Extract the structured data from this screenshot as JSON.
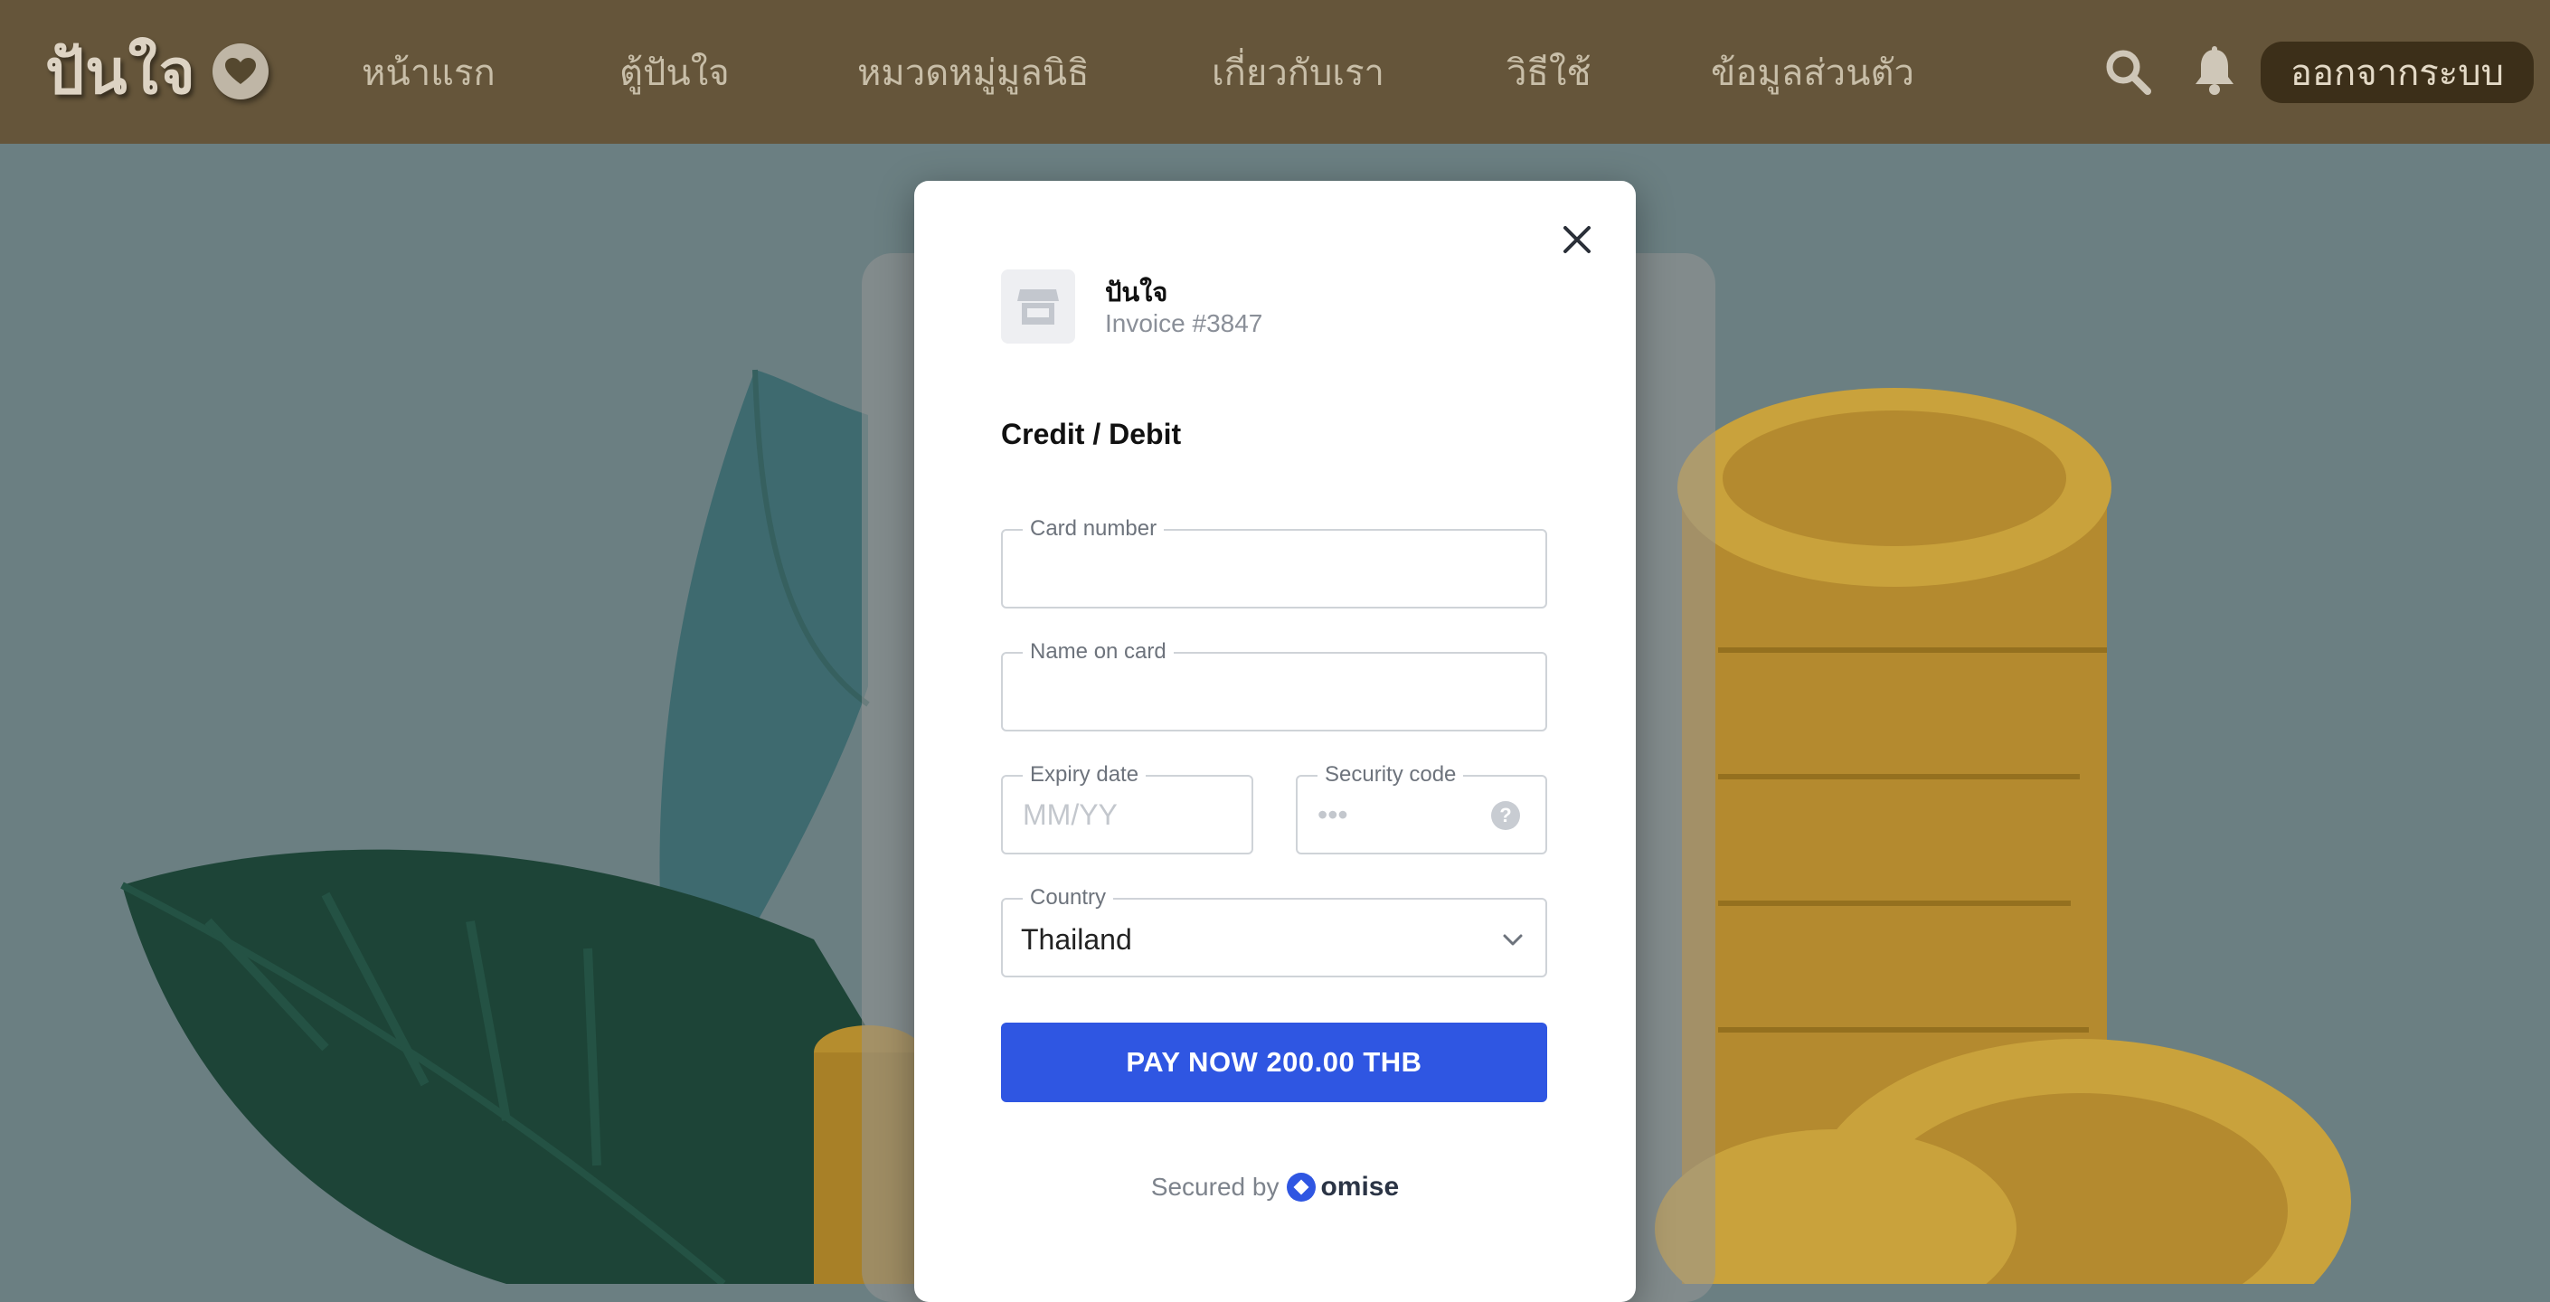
{
  "header": {
    "brand": "ปันใจ",
    "nav": [
      {
        "label": "หน้าแรก"
      },
      {
        "label": "ตู้ปันใจ"
      },
      {
        "label": "หมวดหมู่มูลนิธิ"
      },
      {
        "label": "เกี่ยวกับเรา"
      },
      {
        "label": "วิธีใช้"
      },
      {
        "label": "ข้อมูลส่วนตัว"
      }
    ],
    "icons": {
      "search": "search-icon",
      "notifications": "bell-icon"
    },
    "logout_label": "ออกจากระบบ"
  },
  "payment": {
    "merchant_name": "ปันใจ",
    "invoice": "Invoice #3847",
    "method_title": "Credit / Debit",
    "card_number": {
      "label": "Card number",
      "value": "",
      "placeholder": ""
    },
    "name_on_card": {
      "label": "Name on card",
      "value": "",
      "placeholder": ""
    },
    "expiry": {
      "label": "Expiry date",
      "value": "",
      "placeholder": "MM/YY"
    },
    "security_code": {
      "label": "Security code",
      "value": "",
      "placeholder": "•••",
      "help": "?"
    },
    "country": {
      "label": "Country",
      "value": "Thailand"
    },
    "pay_label": "PAY NOW 200.00 THB",
    "secured_by": "Secured by",
    "provider": "omise"
  },
  "colors": {
    "header_bg": "#65553a",
    "page_bg": "#6b7f82",
    "pay_button": "#2f56e2",
    "logout_button": "#3c2f19"
  }
}
